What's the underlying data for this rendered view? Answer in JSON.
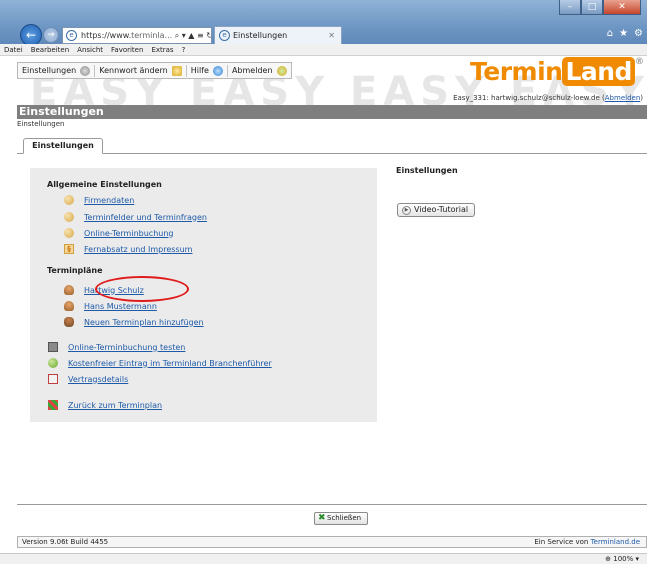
{
  "browser": {
    "address_scheme": "https://www.",
    "address_host": "terminla...",
    "address_icons": "⌕ ▾ ▲ ≡ ↻ ✕",
    "tab_title": "Einstellungen",
    "menu": [
      "Datei",
      "Bearbeiten",
      "Ansicht",
      "Favoriten",
      "Extras",
      "?"
    ]
  },
  "toolbar": {
    "settings_label": "Einstellungen",
    "password_label": "Kennwort ändern",
    "help_label": "Hilfe",
    "logout_label": "Abmelden"
  },
  "watermark": "EASY  EASY  EASY  EASY",
  "logo": {
    "part1": "Termin",
    "part2": "Land",
    "reg": "®"
  },
  "user": {
    "text": "Easy_331: hartwig.schulz@schulz-loew.de (",
    "logout_link": "Abmelden",
    "close_paren": ")"
  },
  "page": {
    "title": "Einstellungen",
    "breadcrumb": "Einstellungen",
    "tab_label": "Einstellungen"
  },
  "general": {
    "heading": "Allgemeine Einstellungen",
    "items": [
      "Firmendaten",
      "Terminfelder und Terminfragen",
      "Online-Terminbuchung",
      "Fernabsatz und Impressum"
    ]
  },
  "plans": {
    "heading": "Terminpläne",
    "items": [
      "Hartwig Schulz",
      "Hans Mustermann",
      "Neuen Terminplan hinzufügen"
    ]
  },
  "extra": {
    "items": [
      "Online-Terminbuchung testen",
      "Kostenfreier Eintrag im Terminland Branchenführer",
      "Vertragsdetails"
    ],
    "back": "Zurück zum Terminplan"
  },
  "right": {
    "title": "Einstellungen",
    "video_label": "Video-Tutorial"
  },
  "close_label": "Schließen",
  "footer": {
    "version": "Version 9.06t Build 4455",
    "service_prefix": "Ein Service von ",
    "service_link": "Terminland.de"
  },
  "zoom": "100%",
  "colors": {
    "accent": "#f08a00",
    "link": "#1e5aa8",
    "highlight": "#e01b1b",
    "title_bar": "#7f7f7f"
  }
}
